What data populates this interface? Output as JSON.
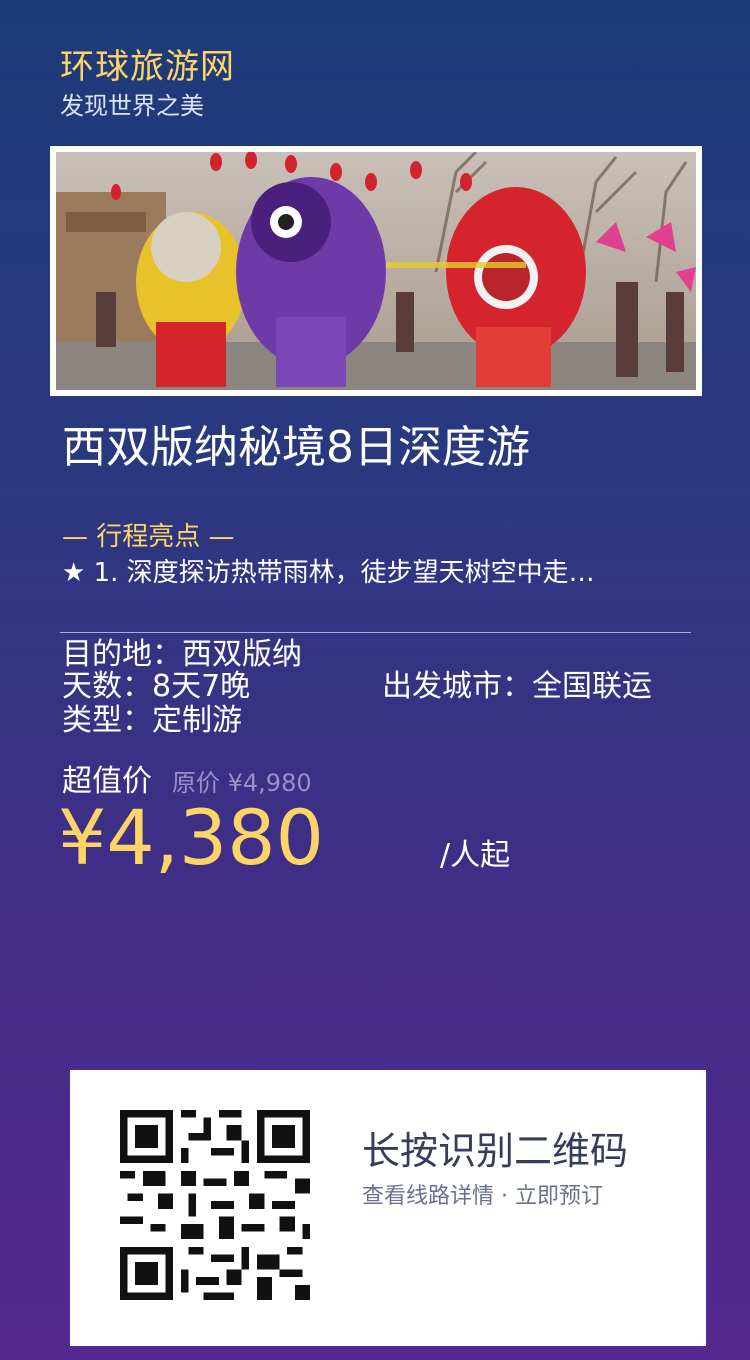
{
  "brand": {
    "title": "环球旅游网",
    "subtitle": "发现世界之美"
  },
  "hero": {
    "image_alt": "lion dance festival photo"
  },
  "tour": {
    "title": "西双版纳秘境8日深度游",
    "highlights_heading": "— 行程亮点 —",
    "highlight_1": "★ 1. 深度探访热带雨林，徒步望天树空中走…"
  },
  "info": {
    "destination": "目的地：西双版纳",
    "days": "天数：8天7晚",
    "departure": "出发城市：全国联运",
    "type": "类型：定制游"
  },
  "price": {
    "label": "超值价",
    "original": "原价 ¥4,980",
    "current": "¥4,380",
    "unit": "/人起"
  },
  "qr": {
    "title": "长按识别二维码",
    "subtitle": "查看线路详情 · 立即预订",
    "icon": "qr-code-icon"
  },
  "colors": {
    "accent": "#ffd467",
    "bg_top": "#1d3b79",
    "bg_bottom": "#56278f"
  }
}
